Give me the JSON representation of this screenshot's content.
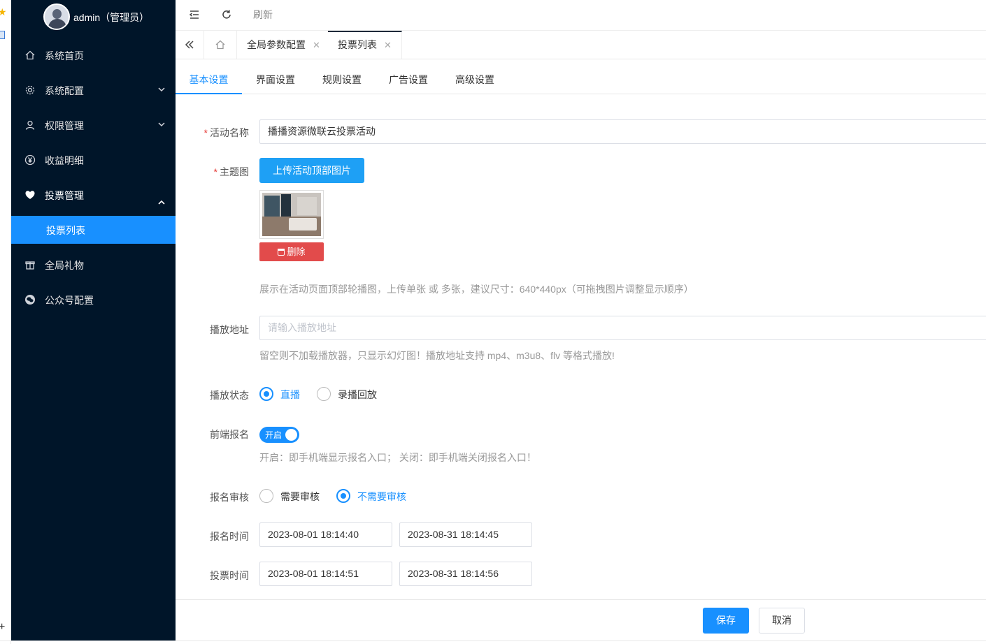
{
  "user": {
    "name": "admin（管理员）"
  },
  "sidebar": {
    "items": [
      {
        "label": "系统首页",
        "icon": "home-icon"
      },
      {
        "label": "系统配置",
        "icon": "gear-icon",
        "arrow": "chevron-down"
      },
      {
        "label": "权限管理",
        "icon": "user-icon",
        "arrow": "chevron-down"
      },
      {
        "label": "收益明细",
        "icon": "yen-icon"
      },
      {
        "label": "投票管理",
        "icon": "heart-icon",
        "arrow": "chevron-up",
        "open": true
      },
      {
        "label": "投票列表",
        "sub": true,
        "active": true
      },
      {
        "label": "全局礼物",
        "icon": "gift-icon"
      },
      {
        "label": "公众号配置",
        "icon": "wechat-icon"
      }
    ]
  },
  "topbar": {
    "refresh_label": "刷新"
  },
  "tabs": [
    {
      "label": "全局参数配置"
    },
    {
      "label": "投票列表",
      "active": true
    }
  ],
  "subtabs": [
    "基本设置",
    "界面设置",
    "规则设置",
    "广告设置",
    "高级设置"
  ],
  "form": {
    "activity_name": {
      "label": "活动名称",
      "value": "播播资源微联云投票活动"
    },
    "theme_image": {
      "label": "主题图",
      "upload_button": "上传活动顶部图片",
      "delete_button": "删除",
      "hint": "展示在活动页面顶部轮播图，上传单张 或 多张，建议尺寸：640*440px（可拖拽图片调整显示顺序）"
    },
    "play_url": {
      "label": "播放地址",
      "placeholder": "请输入播放地址",
      "hint": "留空则不加载播放器，只显示幻灯图！播放地址支持 mp4、m3u8、flv 等格式播放!"
    },
    "play_status": {
      "label": "播放状态",
      "options": [
        "直播",
        "录播回放"
      ],
      "selected": "直播"
    },
    "front_signup": {
      "label": "前端报名",
      "switch_text": "开启",
      "enabled": true,
      "hint": "开启：即手机端显示报名入口； 关闭：即手机端关闭报名入口！"
    },
    "signup_review": {
      "label": "报名审核",
      "options": [
        "需要审核",
        "不需要审核"
      ],
      "selected": "不需要审核"
    },
    "signup_time": {
      "label": "报名时间",
      "start": "2023-08-01 18:14:40",
      "end": "2023-08-31 18:14:45"
    },
    "vote_time": {
      "label": "投票时间",
      "start": "2023-08-01 18:14:51",
      "end": "2023-08-31 18:14:56"
    }
  },
  "footer": {
    "save_label": "保存",
    "cancel_label": "取消"
  },
  "colors": {
    "sidebar_bg": "#001529",
    "accent": "#1890ff",
    "danger": "#e24b4b",
    "required": "#e53935"
  }
}
